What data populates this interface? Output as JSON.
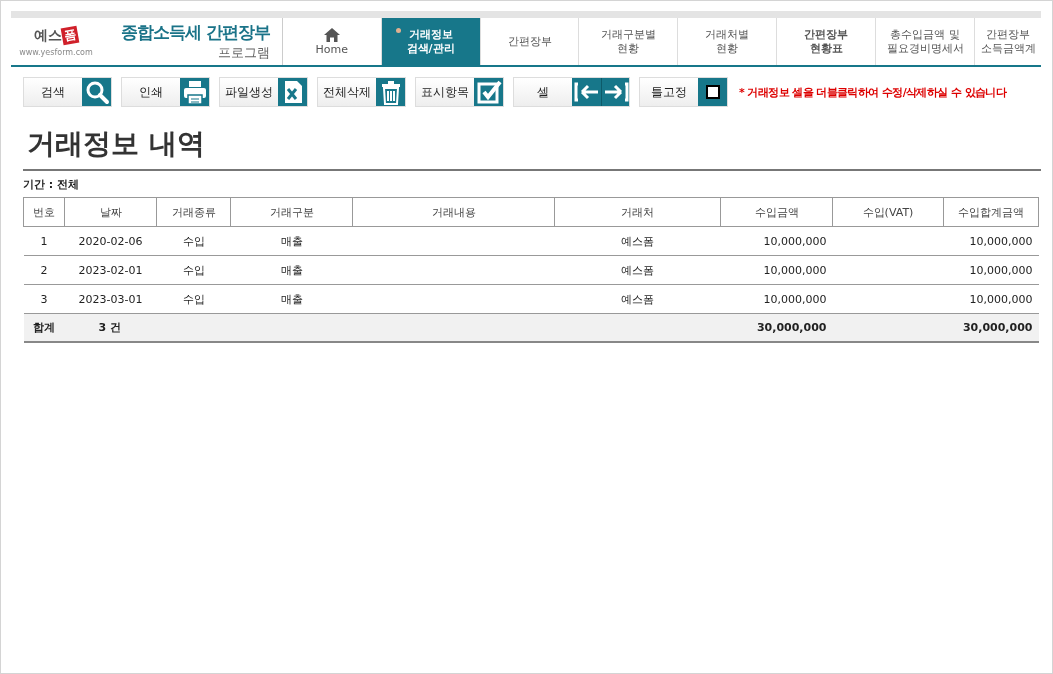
{
  "logo": {
    "brand": "예스",
    "stamp": "폼",
    "url": "www.yesform.com"
  },
  "app_title": {
    "title": "종합소득세 간편장부",
    "subtitle": "프로그램"
  },
  "tabs": [
    {
      "kind": "home",
      "lines": [
        "Home"
      ],
      "selected": false,
      "emphasized": false
    },
    {
      "kind": "text",
      "lines": [
        "거래정보",
        "검색/관리"
      ],
      "selected": true,
      "emphasized": false
    },
    {
      "kind": "text",
      "lines": [
        "간편장부"
      ],
      "selected": false,
      "emphasized": false
    },
    {
      "kind": "text",
      "lines": [
        "거래구분별",
        "현황"
      ],
      "selected": false,
      "emphasized": false
    },
    {
      "kind": "text",
      "lines": [
        "거래처별",
        "현황"
      ],
      "selected": false,
      "emphasized": false
    },
    {
      "kind": "text",
      "lines": [
        "간편장부",
        "현황표"
      ],
      "selected": false,
      "emphasized": true
    },
    {
      "kind": "text",
      "lines": [
        "총수입금액 및",
        "필요경비명세서"
      ],
      "selected": false,
      "emphasized": false
    },
    {
      "kind": "text",
      "lines": [
        "간편장부",
        "소득금액계"
      ],
      "selected": false,
      "emphasized": false
    }
  ],
  "toolbar": [
    {
      "label": "검색",
      "kind": "search"
    },
    {
      "label": "인쇄",
      "kind": "print"
    },
    {
      "label": "파일생성",
      "kind": "excel"
    },
    {
      "label": "전체삭제",
      "kind": "delete"
    },
    {
      "label": "표시항목",
      "kind": "checklist"
    },
    {
      "label": "셀",
      "kind": "arrows"
    },
    {
      "label": "틀고정",
      "kind": "checkbox",
      "checked": false
    }
  ],
  "notice": "* 거래정보 셀을 더블클릭하여 수정/삭제하실 수 있습니다",
  "page_title": "거래정보 내역",
  "period": "기간 : 전체",
  "table": {
    "columns": [
      "번호",
      "날짜",
      "거래종류",
      "거래구분",
      "거래내용",
      "거래처",
      "수입금액",
      "수입(VAT)",
      "수입합계금액"
    ],
    "rows": [
      [
        "1",
        "2020-02-06",
        "수입",
        "매출",
        null,
        "예스폼",
        "10,000,000",
        null,
        "10,000,000"
      ],
      [
        "2",
        "2023-02-01",
        "수입",
        "매출",
        null,
        "예스폼",
        "10,000,000",
        null,
        "10,000,000"
      ],
      [
        "3",
        "2023-03-01",
        "수입",
        "매출",
        null,
        "예스폼",
        "10,000,000",
        null,
        "10,000,000"
      ]
    ],
    "total": {
      "label": "합계",
      "count": "3 건",
      "income": "30,000,000",
      "income_total": "30,000,000"
    }
  }
}
